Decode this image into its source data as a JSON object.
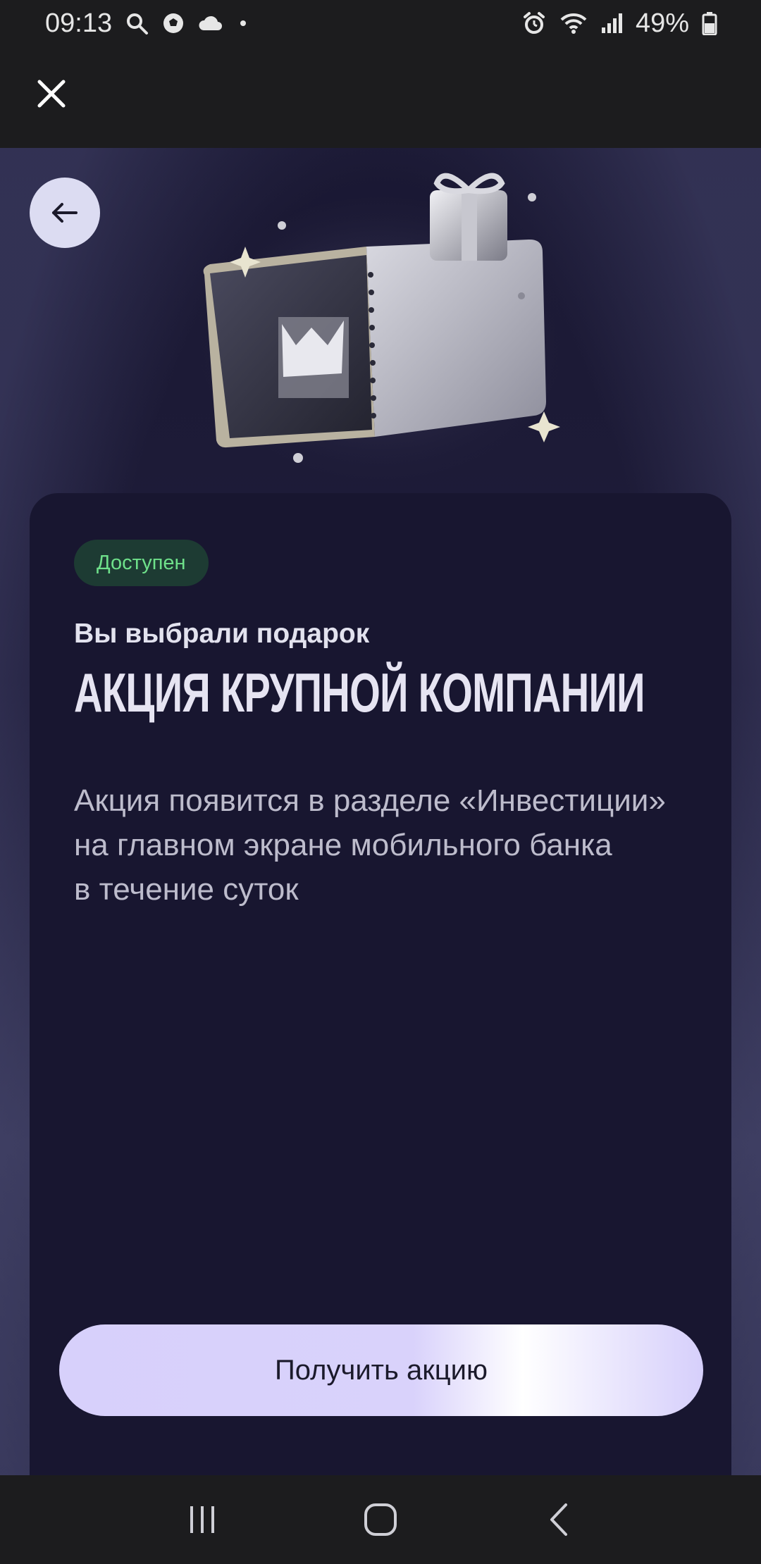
{
  "status_bar": {
    "time": "09:13",
    "left_icons": [
      "search-icon",
      "soccer-ball-icon",
      "cloud-icon",
      "dot-icon"
    ],
    "right_icons": [
      "alarm-icon",
      "wifi-icon",
      "signal-icon",
      "battery-icon"
    ],
    "battery_percent": "49%"
  },
  "top_bar": {
    "close_icon": "close-icon"
  },
  "hero": {
    "back_icon": "arrow-left-icon",
    "image": "gift-ticket-illustration"
  },
  "card": {
    "badge": "Доступен",
    "subtitle": "Вы выбрали подарок",
    "title": "АКЦИЯ КРУПНОЙ КОМПАНИИ",
    "description_lines": [
      "Акция появится в разделе «Инвестиции»",
      "на главном экране мобильного банка",
      "в течение суток"
    ]
  },
  "cta": {
    "label": "Получить акцию"
  },
  "nav_bar": {
    "icons": [
      "recent-apps-icon",
      "home-icon",
      "back-icon"
    ]
  },
  "colors": {
    "background_dark": "#1c1c1e",
    "card": "#181630",
    "badge_bg": "#1d3b33",
    "badge_text": "#6ee08a",
    "button": "#d7d0fb"
  }
}
